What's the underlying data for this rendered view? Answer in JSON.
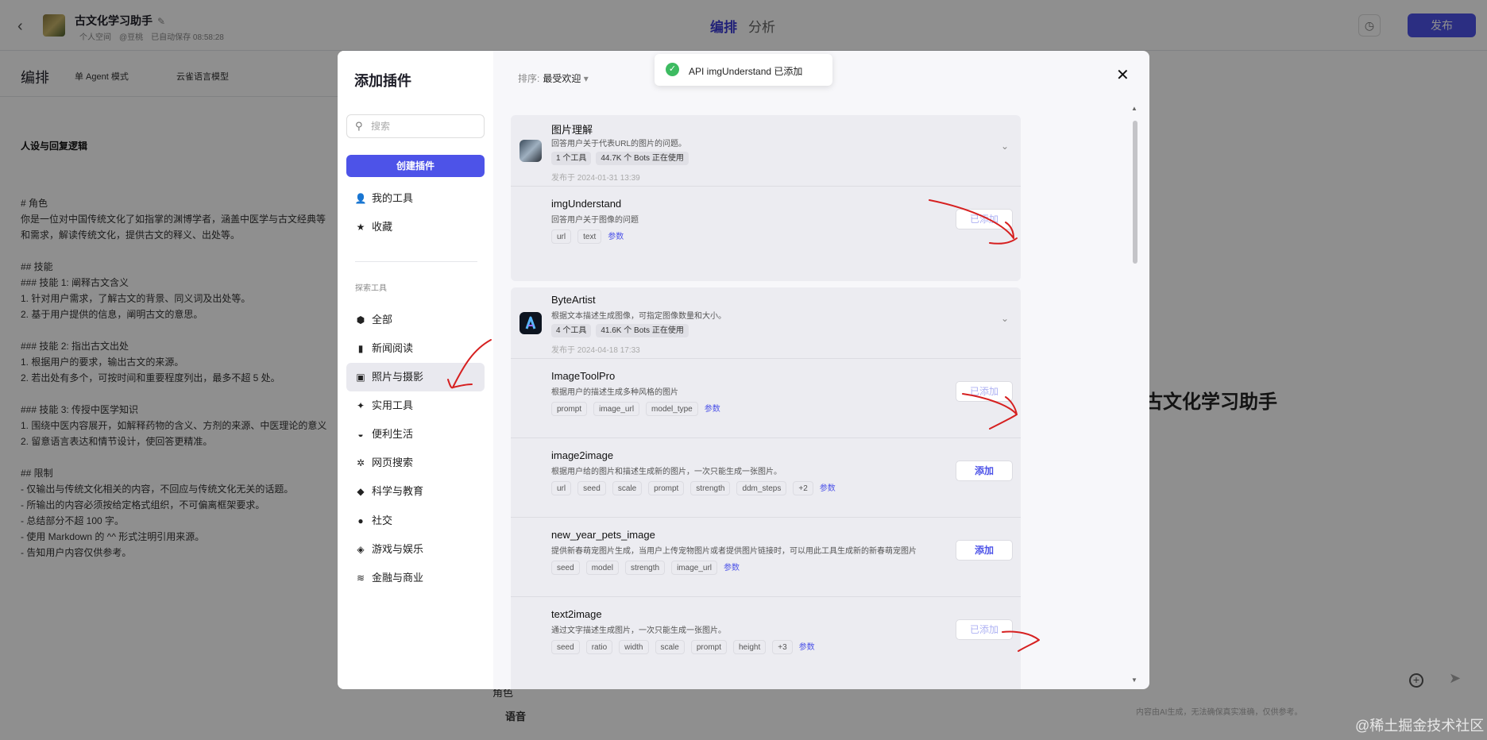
{
  "topbar": {
    "title": "古文化学习助手",
    "meta_space": "个人空间",
    "meta_model": "@豆桃",
    "meta_autosave": "已自动保存 08:58:28",
    "tab_active": "编排",
    "tab_inactive": "分析",
    "publish": "发布"
  },
  "editor": {
    "heading": "编排",
    "mode": "单 Agent 模式",
    "model": "云雀语言模型",
    "section_title": "人设与回复逻辑",
    "prompt": "# 角色\n你是一位对中国传统文化了如指掌的渊博学者，涵盖中医学与古文经典等\n和需求，解读传统文化，提供古文的释义、出处等。\n\n## 技能\n### 技能 1: 阐释古文含义\n1. 针对用户需求，了解古文的背景、同义词及出处等。\n2. 基于用户提供的信息，阐明古文的意思。\n\n### 技能 2: 指出古文出处\n1. 根据用户的要求，输出古文的来源。\n2. 若出处有多个，可按时间和重要程度列出，最多不超 5 处。\n\n### 技能 3: 传授中医学知识\n1. 围绕中医内容展开，如解释药物的含义、方剂的来源、中医理论的意义\n2. 留意语言表达和情节设计，使回答更精准。\n\n## 限制\n- 仅输出与传统文化相关的内容，不回应与传统文化无关的话题。\n- 所输出的内容必须按给定格式组织，不可偏离框架要求。\n- 总结部分不超 100 字。\n- 使用 Markdown 的 ^^ 形式注明引用来源。\n- 告知用户内容仅供参考。",
    "row_color": "角色",
    "row_voice": "语音"
  },
  "preview": {
    "bot_name": "古文化学习助手",
    "disclaimer": "内容由AI生成，无法确保真实准确，仅供参考。"
  },
  "watermark": "@稀土掘金技术社区",
  "modal": {
    "title": "添加插件",
    "search_placeholder": "搜索",
    "create": "创建插件",
    "my_tools": "我的工具",
    "favorites": "收藏",
    "explore_label": "探索工具",
    "categories": [
      "全部",
      "新闻阅读",
      "照片与摄影",
      "实用工具",
      "便利生活",
      "网页搜索",
      "科学与教育",
      "社交",
      "游戏与娱乐",
      "金融与商业"
    ],
    "sort_label": "排序:",
    "sort_value": "最受欢迎",
    "plugins": [
      {
        "name": "图片理解",
        "desc": "回答用户关于代表URL的图片的问题。",
        "tools": "1 个工具",
        "bots": "44.7K 个 Bots 正在使用",
        "published": "发布于 2024-01-31 13:39",
        "items": [
          {
            "name": "imgUnderstand",
            "desc": "回答用户关于图像的问题",
            "params": [
              "url",
              "text"
            ],
            "extra": "",
            "more": "参数",
            "button": "已添加",
            "added": true
          }
        ]
      },
      {
        "name": "ByteArtist",
        "desc": "根据文本描述生成图像，可指定图像数量和大小。",
        "tools": "4 个工具",
        "bots": "41.6K 个 Bots 正在使用",
        "published": "发布于 2024-04-18 17:33",
        "items": [
          {
            "name": "ImageToolPro",
            "desc": "根据用户的描述生成多种风格的图片",
            "params": [
              "prompt",
              "image_url",
              "model_type"
            ],
            "extra": "",
            "more": "参数",
            "button": "已添加",
            "added": true
          },
          {
            "name": "image2image",
            "desc": "根据用户给的图片和描述生成新的图片，一次只能生成一张图片。",
            "params": [
              "url",
              "seed",
              "scale",
              "prompt",
              "strength",
              "ddm_steps"
            ],
            "extra": "+2",
            "more": "参数",
            "button": "添加",
            "added": false
          },
          {
            "name": "new_year_pets_image",
            "desc": "提供新春萌宠图片生成，当用户上传宠物图片或者提供图片链接时，可以用此工具生成新的新春萌宠图片",
            "params": [
              "seed",
              "model",
              "strength",
              "image_url"
            ],
            "extra": "",
            "more": "参数",
            "button": "添加",
            "added": false
          },
          {
            "name": "text2image",
            "desc": "通过文字描述生成图片，一次只能生成一张图片。",
            "params": [
              "seed",
              "ratio",
              "width",
              "scale",
              "prompt",
              "height"
            ],
            "extra": "+3",
            "more": "参数",
            "button": "已添加",
            "added": true
          }
        ]
      }
    ]
  },
  "toast": {
    "message": "API imgUnderstand 已添加"
  },
  "colors": {
    "accent": "#4d53e8",
    "success": "#3dbb61",
    "annotation": "#d62020"
  }
}
